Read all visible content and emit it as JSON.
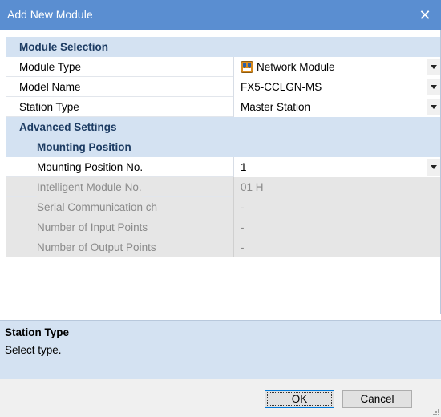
{
  "window": {
    "title": "Add New Module",
    "close_glyph": "✕"
  },
  "grid": {
    "module_selection": {
      "label": "Module Selection",
      "module_type": {
        "label": "Module Type",
        "value": "Network Module",
        "icon": "network-module-icon"
      },
      "model_name": {
        "label": "Model Name",
        "value": "FX5-CCLGN-MS"
      },
      "station_type": {
        "label": "Station Type",
        "value": "Master Station"
      }
    },
    "advanced_settings": {
      "label": "Advanced Settings",
      "mounting_position": {
        "label": "Mounting Position",
        "mounting_position_no": {
          "label": "Mounting Position No.",
          "value": "1"
        },
        "intelligent_module_no": {
          "label": "Intelligent Module No.",
          "value": "01 H"
        },
        "serial_communication_ch": {
          "label": "Serial Communication ch",
          "value": "-"
        },
        "input_points": {
          "label": "Number of Input Points",
          "value": "-"
        },
        "output_points": {
          "label": "Number of Output Points",
          "value": "-"
        }
      }
    }
  },
  "description": {
    "heading": "Station Type",
    "text": "Select type."
  },
  "buttons": {
    "ok": "OK",
    "cancel": "Cancel"
  },
  "colors": {
    "titlebar": "#5a8ed1",
    "category_background": "#d4e2f2",
    "category_text": "#1d3c63",
    "disabled_background": "#e6e6e6",
    "disabled_text": "#8a8a8a"
  }
}
